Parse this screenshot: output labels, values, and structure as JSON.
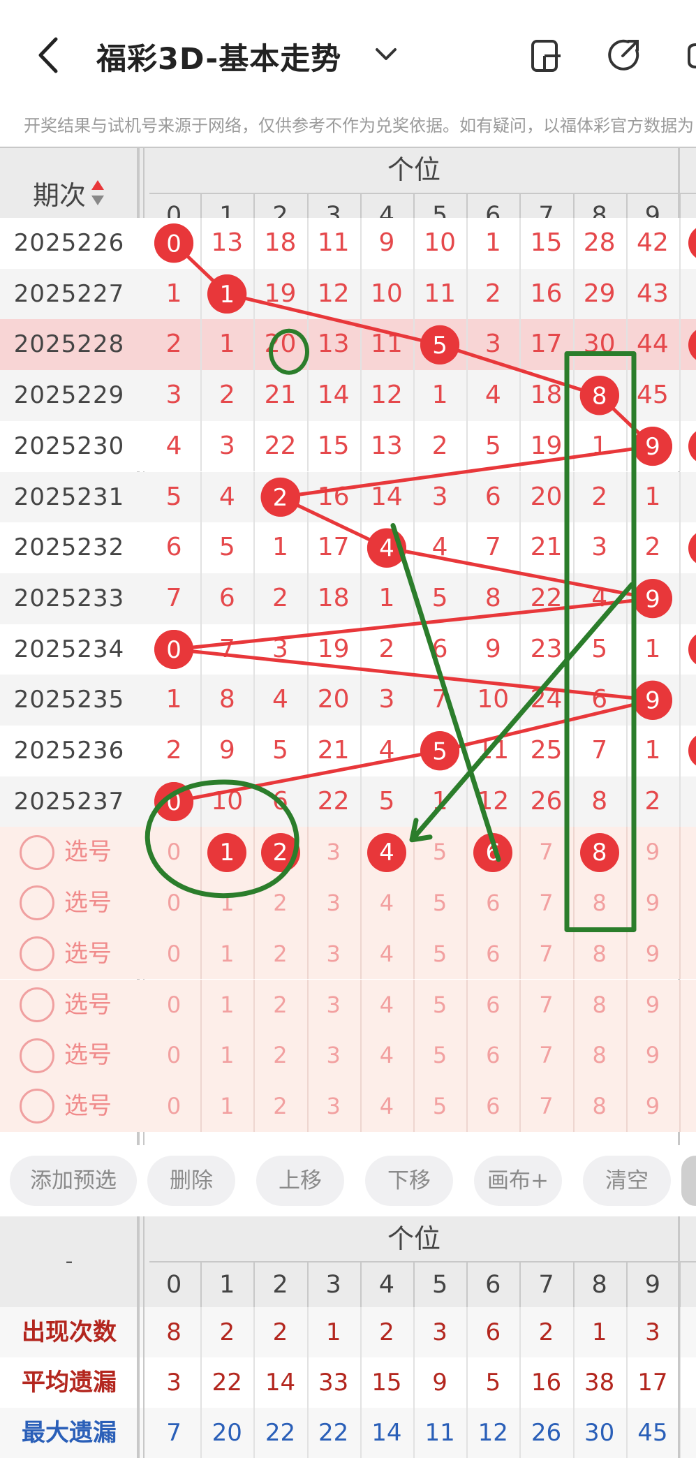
{
  "header": {
    "title": "福彩3D-基本走势",
    "notice": "开奖结果与试机号来源于网络，仅供参考不作为兑奖依据。如有疑问，以福体彩官方数据为"
  },
  "table": {
    "period_header": "期次",
    "group_header": "个位",
    "digits": [
      "0",
      "1",
      "2",
      "3",
      "4",
      "5",
      "6",
      "7",
      "8",
      "9"
    ],
    "rows": [
      {
        "period": "2025226",
        "cells": [
          "0",
          "13",
          "18",
          "11",
          "9",
          "10",
          "1",
          "15",
          "28",
          "42"
        ],
        "hit": 0
      },
      {
        "period": "2025227",
        "cells": [
          "1",
          "1",
          "19",
          "12",
          "10",
          "11",
          "2",
          "16",
          "29",
          "43"
        ],
        "hit": 1
      },
      {
        "period": "2025228",
        "cells": [
          "2",
          "1",
          "20",
          "13",
          "11",
          "5",
          "3",
          "17",
          "30",
          "44"
        ],
        "hit": 5
      },
      {
        "period": "2025229",
        "cells": [
          "3",
          "2",
          "21",
          "14",
          "12",
          "1",
          "4",
          "18",
          "8",
          "45"
        ],
        "hit": 8
      },
      {
        "period": "2025230",
        "cells": [
          "4",
          "3",
          "22",
          "15",
          "13",
          "2",
          "5",
          "19",
          "1",
          "9"
        ],
        "hit": 9
      },
      {
        "period": "2025231",
        "cells": [
          "5",
          "4",
          "2",
          "16",
          "14",
          "3",
          "6",
          "20",
          "2",
          "1"
        ],
        "hit": 2
      },
      {
        "period": "2025232",
        "cells": [
          "6",
          "5",
          "1",
          "17",
          "4",
          "4",
          "7",
          "21",
          "3",
          "2"
        ],
        "hit": 4
      },
      {
        "period": "2025233",
        "cells": [
          "7",
          "6",
          "2",
          "18",
          "1",
          "5",
          "8",
          "22",
          "4",
          "9"
        ],
        "hit": 9
      },
      {
        "period": "2025234",
        "cells": [
          "0",
          "7",
          "3",
          "19",
          "2",
          "6",
          "9",
          "23",
          "5",
          "1"
        ],
        "hit": 0
      },
      {
        "period": "2025235",
        "cells": [
          "1",
          "8",
          "4",
          "20",
          "3",
          "7",
          "10",
          "24",
          "6",
          "9"
        ],
        "hit": 9
      },
      {
        "period": "2025236",
        "cells": [
          "2",
          "9",
          "5",
          "21",
          "4",
          "5",
          "11",
          "25",
          "7",
          "1"
        ],
        "hit": 5
      },
      {
        "period": "2025237",
        "cells": [
          "0",
          "10",
          "6",
          "22",
          "5",
          "1",
          "12",
          "26",
          "8",
          "2"
        ],
        "hit": 0
      }
    ]
  },
  "selection": {
    "label": "选号",
    "rows": [
      {
        "picked": [
          1,
          2,
          4,
          6,
          8
        ]
      },
      {
        "picked": []
      },
      {
        "picked": []
      },
      {
        "picked": []
      },
      {
        "picked": []
      },
      {
        "picked": []
      }
    ]
  },
  "toolbar": {
    "buttons": [
      "添加预选",
      "删除",
      "上移",
      "下移",
      "画布+",
      "清空"
    ]
  },
  "stats": {
    "corner": "-",
    "group_header": "个位",
    "rows": [
      {
        "label": "出现次数",
        "values": [
          "8",
          "2",
          "2",
          "1",
          "2",
          "3",
          "6",
          "2",
          "1",
          "3"
        ],
        "color": "#b3261e"
      },
      {
        "label": "平均遗漏",
        "values": [
          "3",
          "22",
          "14",
          "33",
          "15",
          "9",
          "5",
          "16",
          "38",
          "17"
        ],
        "color": "#b3261e"
      },
      {
        "label": "最大遗漏",
        "values": [
          "7",
          "20",
          "22",
          "22",
          "14",
          "11",
          "12",
          "26",
          "30",
          "45"
        ],
        "color": "#2a5fb8"
      }
    ]
  },
  "colors": {
    "accent_red": "#e8373a",
    "annotation_green": "#2b7d2b",
    "highlight_row": "#f8d5d5",
    "selection_bg": "#fdeee9"
  }
}
